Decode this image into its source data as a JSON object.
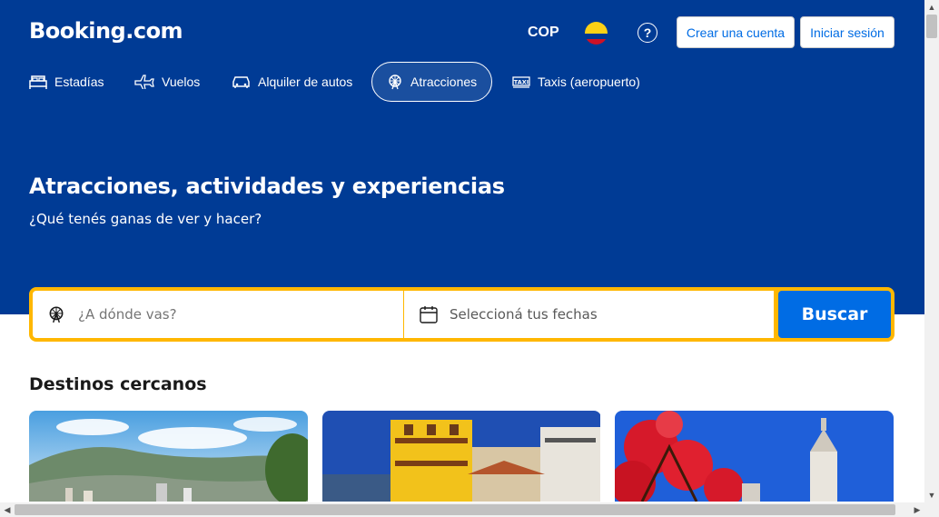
{
  "header": {
    "logo": "Booking.com",
    "currency": "COP",
    "flag_colors": [
      "#fcd116",
      "#003893",
      "#ce1126"
    ],
    "help_icon": "question-circle-icon",
    "create_account": "Crear una cuenta",
    "login": "Iniciar sesión"
  },
  "nav": {
    "items": [
      {
        "label": "Estadías",
        "icon": "bed-icon"
      },
      {
        "label": "Vuelos",
        "icon": "plane-icon"
      },
      {
        "label": "Alquiler de autos",
        "icon": "car-icon"
      },
      {
        "label": "Atracciones",
        "icon": "ferris-wheel-icon",
        "active": true
      },
      {
        "label": "Taxis (aeropuerto)",
        "icon": "taxi-icon"
      }
    ]
  },
  "hero": {
    "title": "Atracciones, actividades y experiencias",
    "subtitle": "¿Qué tenés ganas de ver y hacer?"
  },
  "search": {
    "destination_placeholder": "¿A dónde vas?",
    "dates_placeholder": "Seleccioná tus fechas",
    "button": "Buscar"
  },
  "destinations": {
    "title": "Destinos cercanos"
  },
  "colors": {
    "brand_blue": "#003b95",
    "accent_blue": "#006ce4",
    "search_border": "#ffb700"
  }
}
